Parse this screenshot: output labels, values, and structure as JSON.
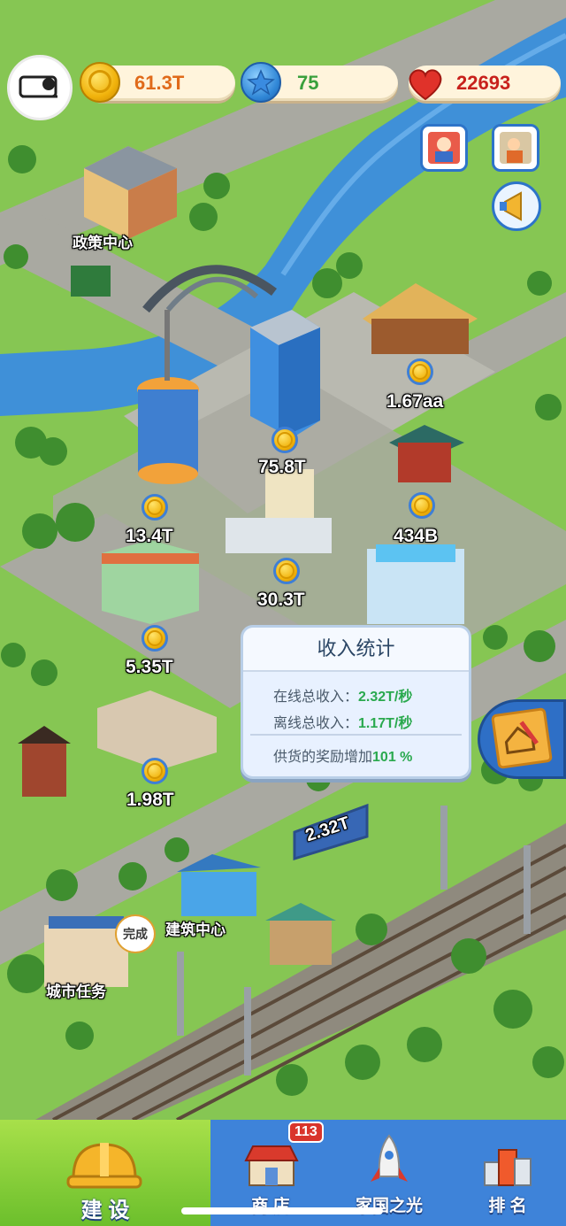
{
  "header": {
    "gold": "61.3T",
    "gems": "75",
    "hearts": "22693",
    "colors": {
      "gold": "#e06a1a",
      "gems": "#39a03c",
      "hearts": "#c8211c"
    }
  },
  "map": {
    "places": {
      "policy_center": "政策中心",
      "build_center": "建筑中心",
      "city_tasks": "城市任务",
      "tasks_bubble": "完成"
    },
    "incomes": {
      "restaurant": "1.67aa",
      "office_tower": "75.8T",
      "round_tower": "13.4T",
      "pagoda_house": "434B",
      "small_office": "30.3T",
      "mall": "5.35T",
      "pool_building": "",
      "apartment": "1.98T"
    },
    "billboard": "2.32T"
  },
  "stats_panel": {
    "title": "收入统计",
    "online_label": "在线总收入：",
    "online_value": "2.32T/秒",
    "offline_label": "离线总收入：",
    "offline_value": "1.17T/秒",
    "bonus_label": "供货的奖励增加",
    "bonus_value": "101 %"
  },
  "nav": {
    "build": "建 设",
    "shop": "商 店",
    "shop_badge": "113",
    "national": "家国之光",
    "rank": "排 名"
  },
  "icons": [
    "avatar",
    "coin-icon",
    "star-gem-icon",
    "heart-icon",
    "event-icon",
    "shop-event-icon",
    "megaphone-icon",
    "blueprint-icon"
  ]
}
